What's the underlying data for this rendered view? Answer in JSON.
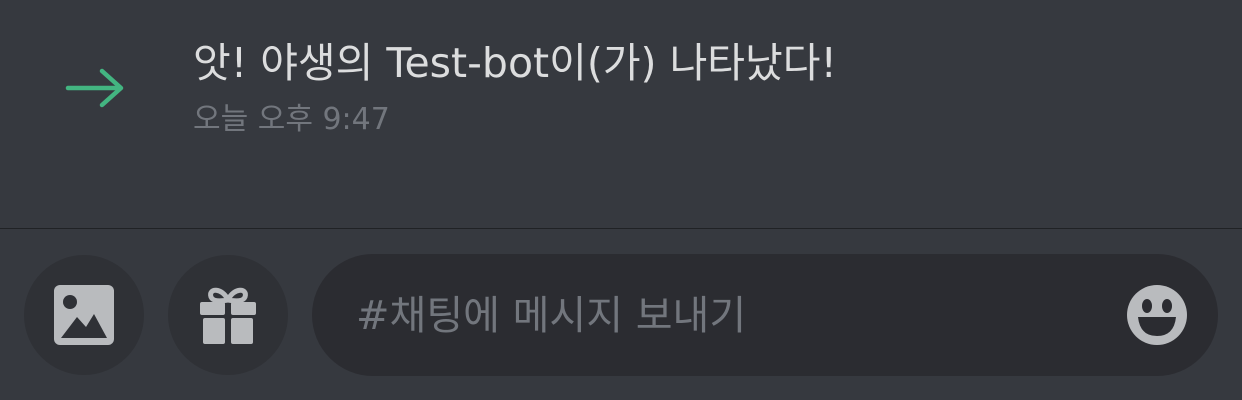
{
  "message": {
    "text": "앗! 야생의 Test-bot이(가) 나타났다!",
    "timestamp": "오늘 오후 9:47",
    "icon": "join-arrow-icon",
    "accent_color": "#43b581"
  },
  "composer": {
    "image_button_icon": "image-icon",
    "gift_button_icon": "gift-icon",
    "placeholder": "#채팅에 메시지 보내기",
    "emoji_button_icon": "emoji-smile-icon"
  },
  "colors": {
    "background": "#36393f",
    "input_background": "#2b2c31",
    "button_background": "#2f3136",
    "text_primary": "#dcddde",
    "text_muted": "#72767d",
    "icon_color": "#b9bbbe"
  }
}
